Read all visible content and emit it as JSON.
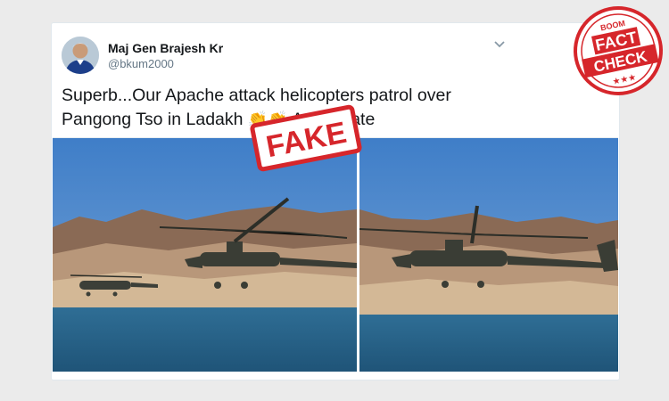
{
  "tweet": {
    "author_name": "Maj Gen Brajesh Kr",
    "handle": "@bkum2000",
    "text_line1": "Superb...Our Apache attack helicopters patrol over",
    "text_line2_start": "Pangong Tso in Ladakh",
    "text_line2_end": "Appreciate",
    "emoji_name": "clapping-hands",
    "emoji_glyph": "👏"
  },
  "stamps": {
    "fake_label": "FAKE",
    "badge_top": "BOOM",
    "badge_word1": "FACT",
    "badge_word2": "CHECK",
    "badge_stars": "★★★"
  },
  "colors": {
    "stamp_red": "#d6262b",
    "sky": "#4c84c4",
    "water": "#2e6b8f"
  }
}
